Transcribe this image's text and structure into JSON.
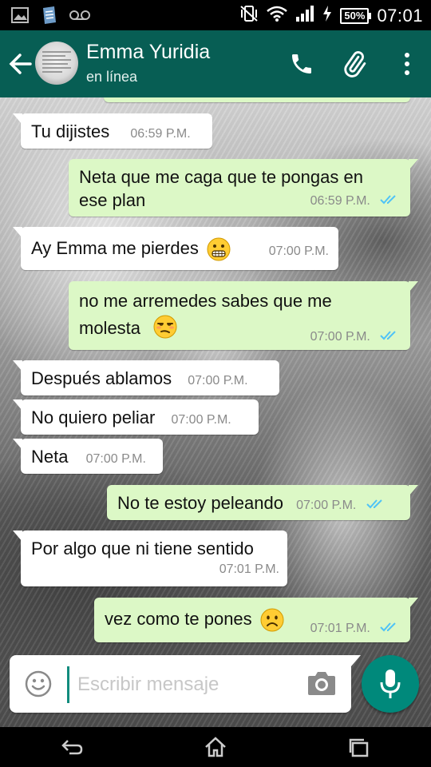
{
  "status_bar": {
    "battery_percent": "50%",
    "time": "07:01"
  },
  "header": {
    "contact_name": "Emma Yuridia",
    "contact_status": "en línea"
  },
  "messages": [
    {
      "direction": "in",
      "text": "Tu dijistes",
      "time": "06:59 P.M."
    },
    {
      "direction": "out",
      "text": "Neta que me caga que te pongas en ese plan",
      "time": "06:59 P.M.",
      "read": true
    },
    {
      "direction": "in",
      "text": "Ay Emma me pierdes",
      "emoji": "grimacing-face",
      "time": "07:00 P.M."
    },
    {
      "direction": "out",
      "text": "no me arremedes sabes que me molesta",
      "emoji": "unamused-face",
      "time": "07:00 P.M.",
      "read": true
    },
    {
      "direction": "in",
      "text": "Después ablamos",
      "time": "07:00 P.M."
    },
    {
      "direction": "in",
      "text": "No quiero peliar",
      "time": "07:00 P.M."
    },
    {
      "direction": "in",
      "text": "Neta",
      "time": "07:00 P.M."
    },
    {
      "direction": "out",
      "text": "No te estoy peleando",
      "time": "07:00 P.M.",
      "read": true
    },
    {
      "direction": "in",
      "text": "Por algo que ni tiene sentido",
      "time": "07:01 P.M."
    },
    {
      "direction": "out",
      "text": "vez como te pones",
      "emoji": "frowning-face",
      "time": "07:01 P.M.",
      "read": true
    }
  ],
  "composer": {
    "placeholder": "Escribir mensaje"
  },
  "colors": {
    "appbar": "#075e54",
    "outgoing_bubble": "#dcf8c6",
    "incoming_bubble": "#ffffff",
    "mic_button": "#00897b",
    "read_ticks": "#4fc3f7"
  }
}
